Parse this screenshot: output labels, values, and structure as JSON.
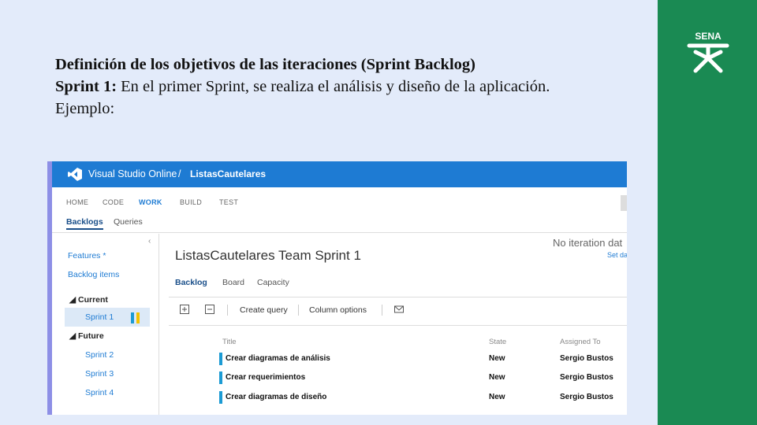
{
  "slide": {
    "title": "Definición de los objetivos de las iteraciones (Sprint Backlog)",
    "sprint_label": "Sprint 1:",
    "sprint_text": " En el primer Sprint, se realiza el análisis y diseño de la aplicación.",
    "example_label": "Ejemplo:"
  },
  "logo": {
    "text": "SENA",
    "color": "#1a8a53"
  },
  "vso": {
    "app_name": "Visual Studio Online",
    "separator": "/",
    "project": "ListasCautelares",
    "hubs": [
      "HOME",
      "CODE",
      "WORK",
      "BUILD",
      "TEST"
    ],
    "active_hub": "WORK",
    "subtabs": [
      "Backlogs",
      "Queries"
    ],
    "left": {
      "features": "Features *",
      "backlog_items": "Backlog items",
      "current_group": "Current",
      "current_sprint": "Sprint 1",
      "future_group": "Future",
      "future_sprints": [
        "Sprint 2",
        "Sprint 3",
        "Sprint 4"
      ]
    },
    "main": {
      "heading": "ListasCautelares Team Sprint 1",
      "no_iteration": "No iteration dat",
      "set_dates": "Set da",
      "tabs": [
        "Backlog",
        "Board",
        "Capacity"
      ],
      "toolbar": {
        "create_query": "Create query",
        "column_options": "Column options"
      },
      "columns": [
        "Title",
        "State",
        "Assigned To"
      ],
      "rows": [
        {
          "title": "Crear diagramas de análisis",
          "state": "New",
          "assigned": "Sergio Bustos"
        },
        {
          "title": "Crear requerimientos",
          "state": "New",
          "assigned": "Sergio Bustos"
        },
        {
          "title": "Crear diagramas de diseño",
          "state": "New",
          "assigned": "Sergio Bustos"
        }
      ]
    },
    "colors": {
      "header": "#1e7bd3",
      "accent_bar": "#8d8fe6",
      "row_marker": "#1c9bd4"
    }
  }
}
